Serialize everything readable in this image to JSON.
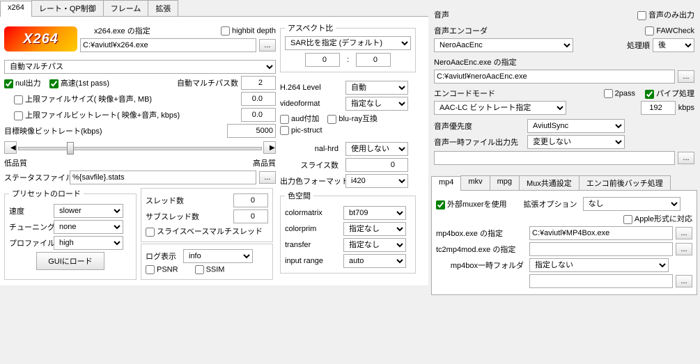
{
  "tabs": {
    "x264": "x264",
    "rateqp": "レート・QP制御",
    "frame": "フレーム",
    "ext": "拡張"
  },
  "x264path": {
    "label": "x264.exe の指定",
    "highbit": "highbit depth",
    "value": "C:¥aviutl¥x264.exe",
    "browse": "..."
  },
  "multipass_mode": "自動マルチパス",
  "nul_out": "nul出力",
  "fast1st": "高速(1st pass)",
  "autopass_label": "自動マルチパス数",
  "autopass_val": "2",
  "upper_filesize": "上限ファイルサイズ( 映像+音声, MB)",
  "upper_filesize_val": "0.0",
  "upper_filerate": "上限ファイルビットレート( 映像+音声, kbps)",
  "upper_filerate_val": "0.0",
  "target_br_label": "目標映像ビットレート(kbps)",
  "target_br_val": "5000",
  "qual_low": "低品質",
  "qual_high": "高品質",
  "status_label": "ステータスファイル",
  "status_val": "%{savfile}.stats",
  "preset": {
    "legend": "プリセットのロード",
    "speed": "速度",
    "speed_val": "slower",
    "tune": "チューニング",
    "tune_val": "none",
    "profile": "プロファイル",
    "profile_val": "high",
    "load_btn": "GUIにロード"
  },
  "threads": {
    "threads": "スレッド数",
    "threads_val": "0",
    "subthreads": "サブスレッド数",
    "subthreads_val": "0",
    "slicebase": "スライスベースマルチスレッド"
  },
  "log": {
    "label": "ログ表示",
    "val": "info",
    "psnr": "PSNR",
    "ssim": "SSIM"
  },
  "aspect": {
    "legend": "アスペクト比",
    "mode": "SAR比を指定 (デフォルト)",
    "v1": "0",
    "colon": ":",
    "v2": "0"
  },
  "h264level": {
    "label": "H.264 Level",
    "val": "自動"
  },
  "videoformat": {
    "label": "videoformat",
    "val": "指定なし"
  },
  "aud": "aud付加",
  "bluray": "blu-ray互換",
  "picstruct": "pic-struct",
  "nalhrd": {
    "label": "nal-hrd",
    "val": "使用しない"
  },
  "slices": {
    "label": "スライス数",
    "val": "0"
  },
  "outcolor": {
    "label": "出力色フォーマット",
    "val": "i420"
  },
  "colorspace": {
    "legend": "色空間",
    "colormatrix": "colormatrix",
    "colormatrix_val": "bt709",
    "colorprim": "colorprim",
    "colorprim_val": "指定なし",
    "transfer": "transfer",
    "transfer_val": "指定なし",
    "inputrange": "input range",
    "inputrange_val": "auto"
  },
  "audio": {
    "title": "音声",
    "audio_only": "音声のみ出力",
    "fawcheck": "FAWCheck",
    "encoder_label": "音声エンコーダ",
    "encoder_val": "NeroAacEnc",
    "order_label": "処理順",
    "order_val": "後",
    "exe_label": "NeroAacEnc.exe の指定",
    "exe_val": "C:¥aviutl¥neroAacEnc.exe",
    "mode_label": "エンコードモード",
    "mode_val": "AAC-LC ビットレート指定",
    "twopass": "2pass",
    "pipe": "パイプ処理",
    "bitrate_val": "192",
    "kbps": "kbps",
    "priority_label": "音声優先度",
    "priority_val": "AviutlSync",
    "tempout_label": "音声一時ファイル出力先",
    "tempout_val": "変更しない"
  },
  "muxtabs": {
    "mp4": "mp4",
    "mkv": "mkv",
    "mpg": "mpg",
    "common": "Mux共通設定",
    "batch": "エンコ前後バッチ処理"
  },
  "mux": {
    "ext_muxer": "外部muxerを使用",
    "ext_opt_label": "拡張オプション",
    "ext_opt_val": "なし",
    "apple": "Apple形式に対応",
    "mp4box_label": "mp4box.exe の指定",
    "mp4box_val": "C:¥aviutl¥MP4Box.exe",
    "tc2mp4_label": "tc2mp4mod.exe の指定",
    "tc2mp4_val": "",
    "tmp_label": "mp4box一時フォルダ",
    "tmp_val": "指定しない",
    "browse": "..."
  }
}
